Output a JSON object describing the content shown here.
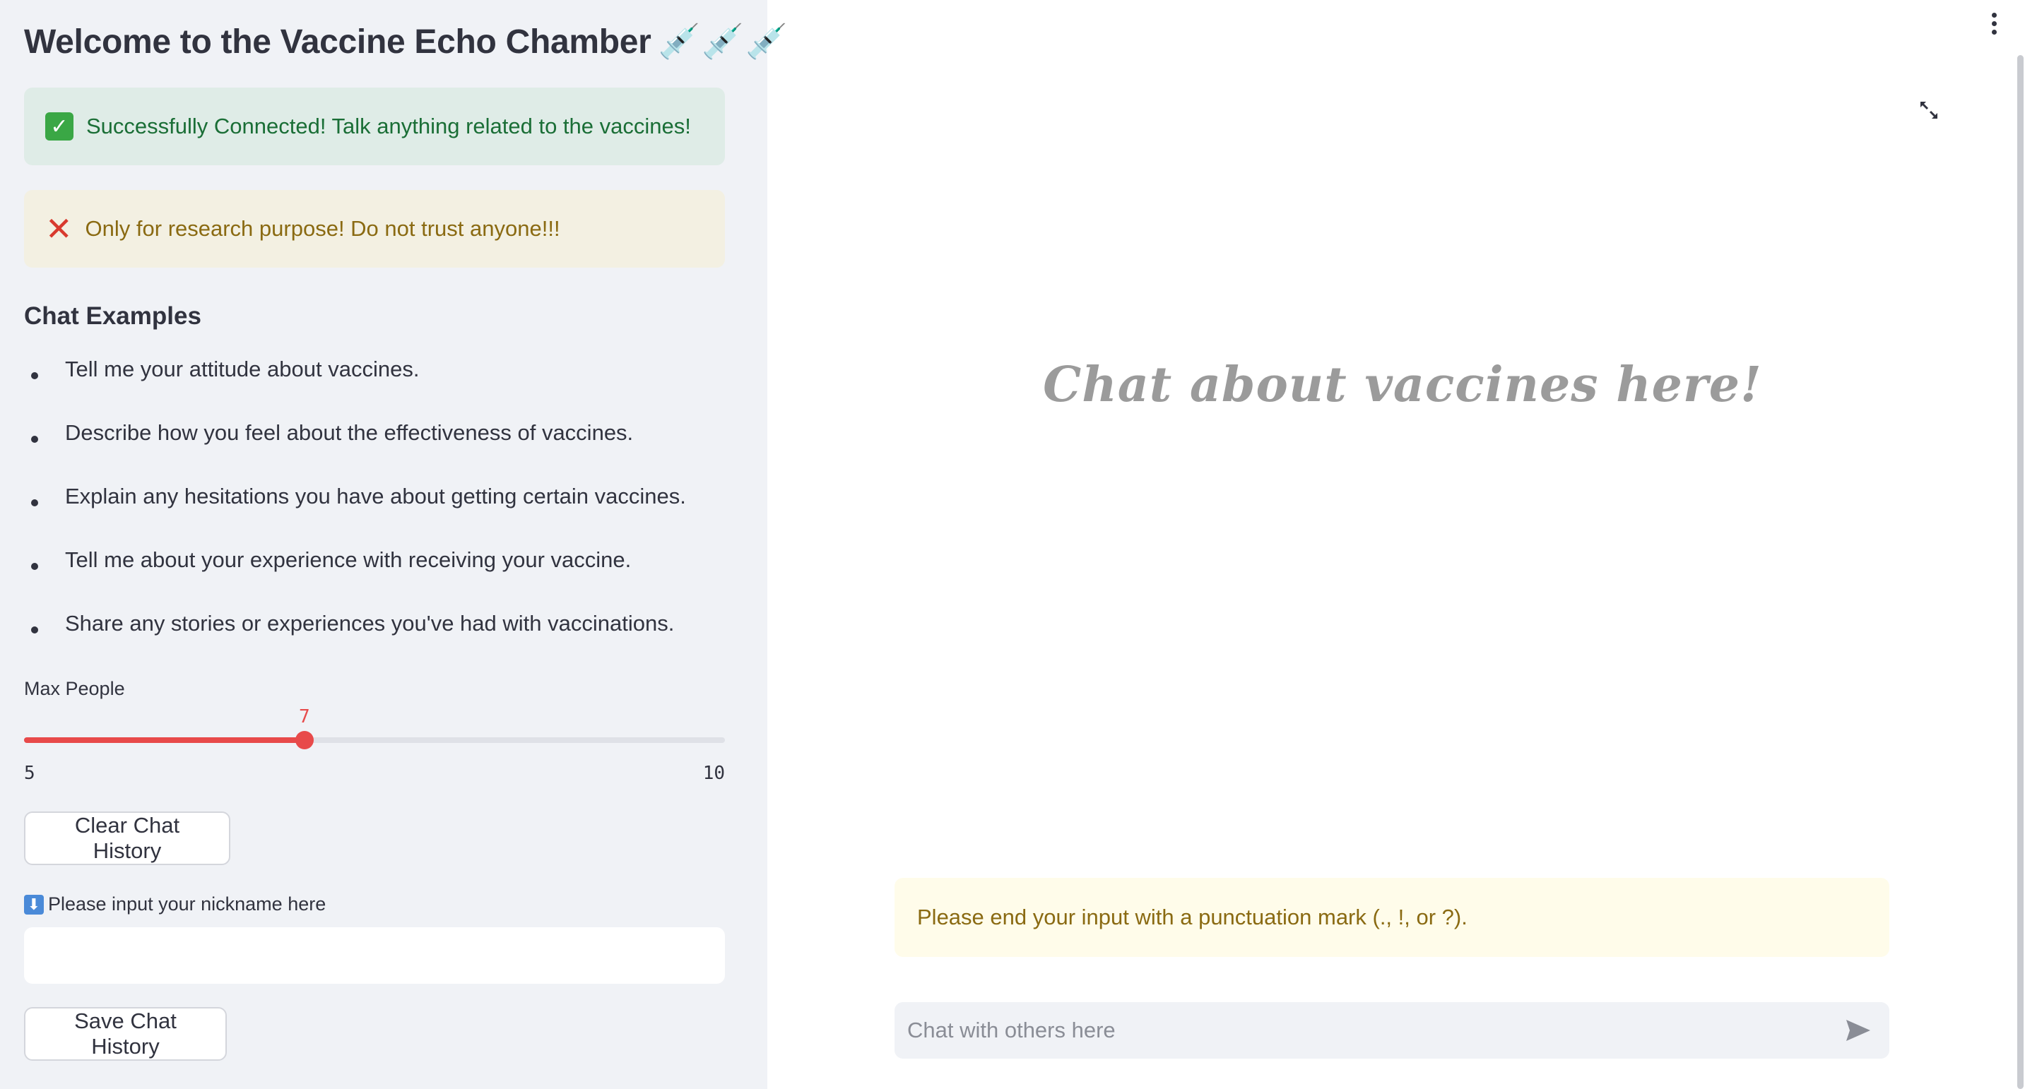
{
  "sidebar": {
    "title": "Welcome to the Vaccine Echo Chamber",
    "title_emoji": "💉💉💉",
    "success_message": "Successfully Connected! Talk anything related to the vaccines!",
    "success_icon": "✓",
    "warning_message": "Only for research purpose! Do not trust anyone!!!",
    "warning_icon": "✕",
    "examples_heading": "Chat Examples",
    "examples": [
      "Tell me your attitude about vaccines.",
      "Describe how you feel about the effectiveness of vaccines.",
      "Explain any hesitations you have about getting certain vaccines.",
      "Tell me about your experience with receiving your vaccine.",
      "Share any stories or experiences you've had with vaccinations."
    ],
    "slider": {
      "label": "Max People",
      "value": "7",
      "min": "5",
      "max": "10",
      "fraction": 0.4
    },
    "clear_button": "Clear Chat History",
    "nickname_label": "Please input your nickname here",
    "nickname_icon": "⬇",
    "nickname_value": "",
    "save_button": "Save Chat History"
  },
  "main": {
    "placeholder_title": "Chat about vaccines here!",
    "notice": "Please end your input with a punctuation mark (., !, or ?).",
    "chat_placeholder": "Chat with others here"
  },
  "colors": {
    "accent": "#e84a4a",
    "sidebar_bg": "#f0f2f6",
    "success_bg": "#dfece7",
    "warning_bg": "#f3f0e2"
  }
}
